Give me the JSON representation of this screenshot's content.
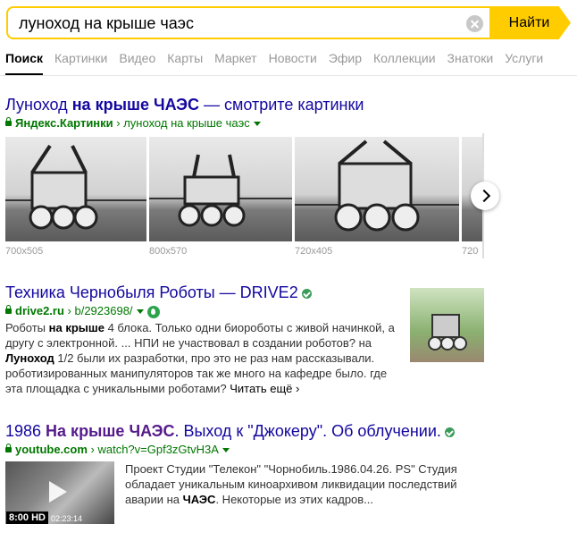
{
  "search": {
    "query": "луноход на крыше чаэс",
    "submit_label": "Найти"
  },
  "nav": {
    "tabs": [
      "Поиск",
      "Картинки",
      "Видео",
      "Карты",
      "Маркет",
      "Новости",
      "Эфир",
      "Коллекции",
      "Знатоки",
      "Услуги"
    ]
  },
  "results": [
    {
      "title_pre": "Луноход ",
      "title_bold": "на крыше ЧАЭС",
      "title_post": " — смотрите картинки",
      "site": "Яндекс.Картинки",
      "path": "луноход на крыше чаэс",
      "images": [
        {
          "size": "700x505"
        },
        {
          "size": "800x570"
        },
        {
          "size": "720x405"
        },
        {
          "size": "720"
        }
      ]
    },
    {
      "title": "Техника Чернобыля Роботы — DRIVE2",
      "site": "drive2.ru",
      "path": "b/2923698/",
      "snippet": {
        "p1": "Роботы ",
        "b1": "на крыше",
        "p2": " 4 блока. Только одни биороботы с живой начинкой, а другу с электронной. ... НПИ не участвовал в создании роботов? на ",
        "b2": "Луноход",
        "p3": " 1/2 были их разработки, про это не раз нам рассказывали. роботизированных манипуляторов так же много на кафедре было. где эта площадка с уникальными роботами?",
        "more": " Читать ещё"
      }
    },
    {
      "title_pre": "1986 ",
      "title_bold": "На крыше ЧАЭС",
      "title_post": ". Выход к \"Джокеру\". Об облучении.",
      "site": "youtube.com",
      "path": "watch?v=Gpf3zGtvH3A",
      "snippet": {
        "p1": "Проект Студии \"Телекон\" \"Чорнобиль.1986.04.26. PS\" Студия обладает уникальным киноархивом ликвидации последствий аварии на ",
        "b1": "ЧАЭС",
        "p2": ". Некоторые из этих кадров..."
      },
      "video": {
        "quality": "8:00 HD",
        "duration": "02:23:14"
      }
    }
  ],
  "colors": {
    "accent": "#ffcc00",
    "link": "#13079f",
    "visited": "#551a8b",
    "url": "#007700"
  }
}
